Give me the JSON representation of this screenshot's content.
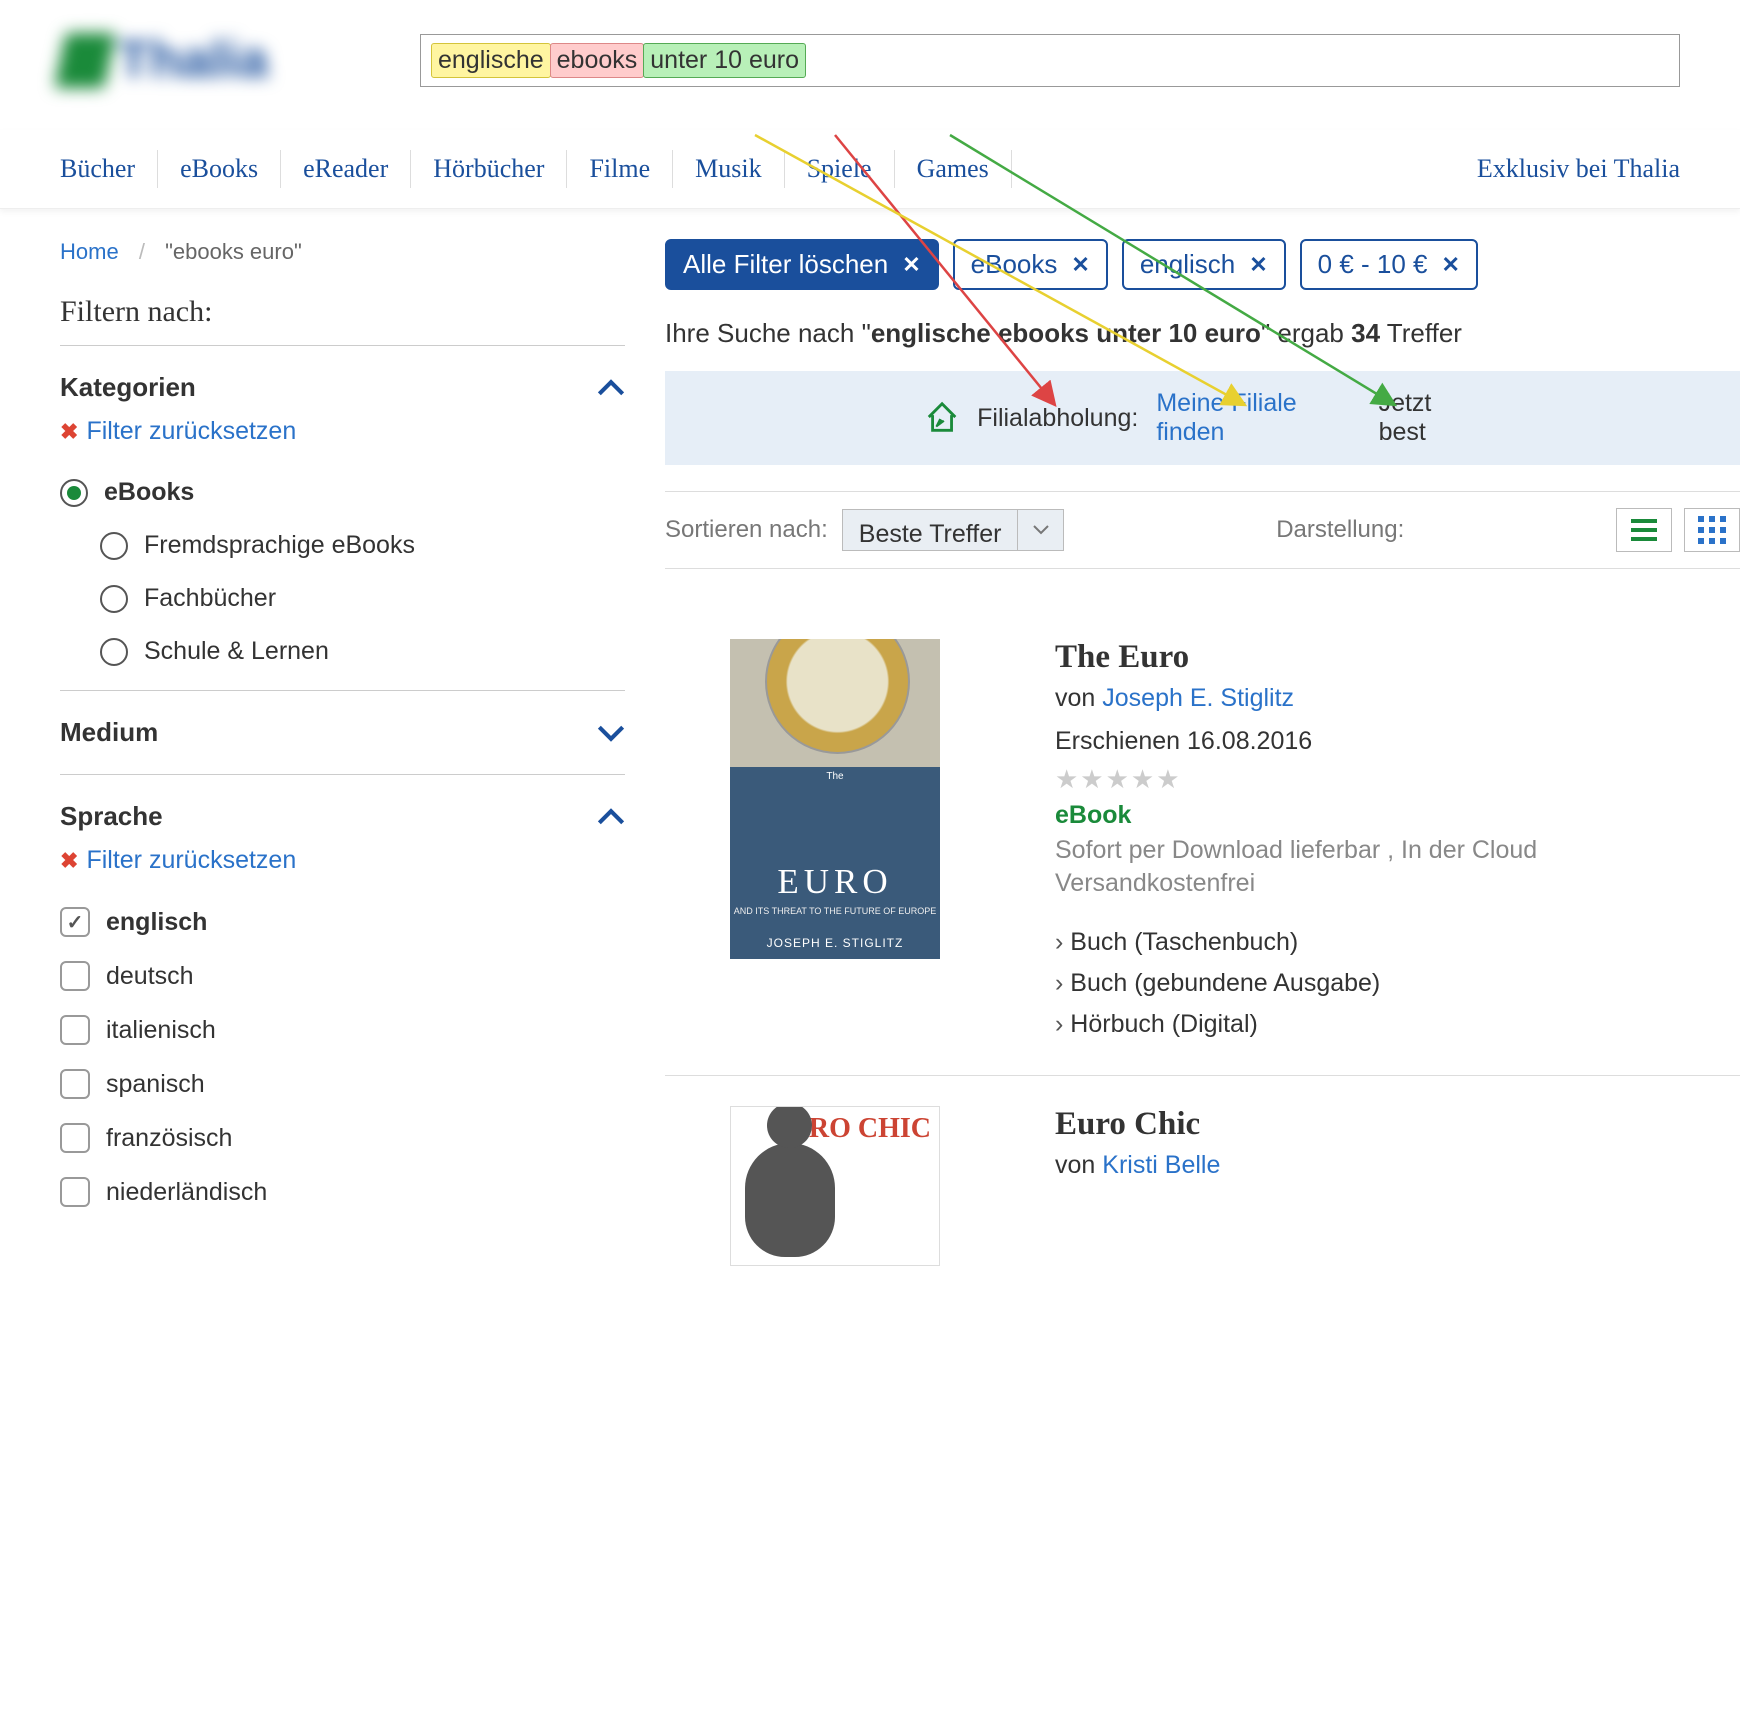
{
  "logo_text": "Thalia",
  "search": {
    "tags": [
      "englische",
      "ebooks",
      "unter 10 euro"
    ]
  },
  "nav": [
    "Bücher",
    "eBooks",
    "eReader",
    "Hörbücher",
    "Filme",
    "Musik",
    "Spiele",
    "Games"
  ],
  "nav_last": "Exklusiv bei Thalia",
  "breadcrumb": {
    "home": "Home",
    "current": "\"ebooks euro\""
  },
  "sidebar": {
    "title": "Filtern nach:",
    "reset_label": "Filter zurücksetzen",
    "sections": {
      "kategorien": {
        "title": "Kategorien",
        "open": true,
        "reset": true,
        "options": [
          {
            "label": "eBooks",
            "selected": true
          },
          {
            "label": "Fremdsprachige eBooks"
          },
          {
            "label": "Fachbücher"
          },
          {
            "label": "Schule & Lernen"
          }
        ]
      },
      "medium": {
        "title": "Medium",
        "open": false
      },
      "sprache": {
        "title": "Sprache",
        "open": true,
        "reset": true,
        "options": [
          {
            "label": "englisch",
            "checked": true
          },
          {
            "label": "deutsch"
          },
          {
            "label": "italienisch"
          },
          {
            "label": "spanisch"
          },
          {
            "label": "französisch"
          },
          {
            "label": "niederländisch"
          }
        ]
      }
    }
  },
  "chips": {
    "clear_all": "Alle Filter löschen",
    "items": [
      "eBooks",
      "englisch",
      "0 € - 10 €"
    ]
  },
  "result_summary": {
    "prefix": "Ihre Suche nach \"",
    "query": "englische ebooks unter 10 euro",
    "mid": "\" ergab ",
    "count": "34",
    "suffix": " Treffer"
  },
  "pickup": {
    "label": "Filialabholung:",
    "link": "Meine Filiale finden",
    "right": "Jetzt best"
  },
  "toolbar": {
    "sort_label": "Sortieren nach:",
    "sort_value": "Beste Treffer",
    "view_label": "Darstellung:"
  },
  "results": [
    {
      "title": "The Euro",
      "author_prefix": "von ",
      "author": "Joseph E. Stiglitz",
      "date_prefix": "Erschienen ",
      "date": "16.08.2016",
      "format": "eBook",
      "avail1": "Sofort per Download lieferbar , In der Cloud",
      "avail2": "Versandkostenfrei",
      "cover": {
        "title": "EURO",
        "sub": "AND ITS THREAT TO\nTHE FUTURE OF EUROPE",
        "author": "JOSEPH E. STIGLITZ"
      },
      "formats": [
        "Buch (Taschenbuch)",
        "Buch (gebundene Ausgabe)",
        "Hörbuch (Digital)"
      ]
    },
    {
      "title": "Euro Chic",
      "author_prefix": "von ",
      "author": "Kristi Belle",
      "cover": {
        "title": "EURO\nCHIC"
      }
    }
  ]
}
